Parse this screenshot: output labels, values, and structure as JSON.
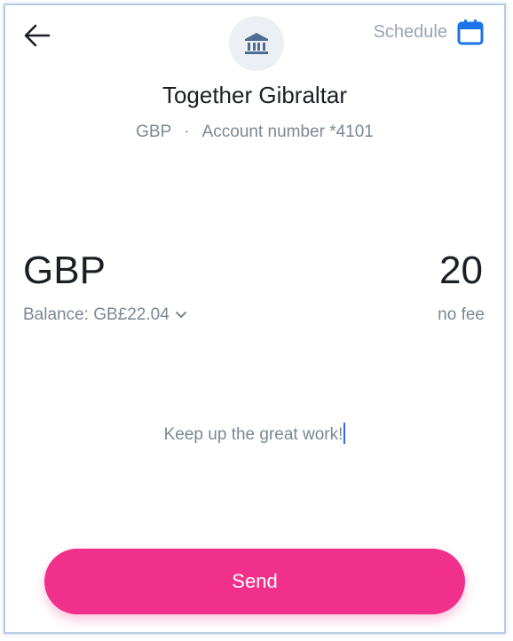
{
  "header": {
    "back_icon": "arrow-left-icon",
    "bank_icon": "bank-icon",
    "schedule_label": "Schedule",
    "schedule_icon": "calendar-icon"
  },
  "recipient": {
    "name": "Together Gibraltar",
    "currency": "GBP",
    "separator": "·",
    "account": "Account number *4101"
  },
  "transfer": {
    "currency": "GBP",
    "amount": "20",
    "balance": "Balance: GB£22.04",
    "balance_icon": "chevron-down-icon",
    "fee": "no fee"
  },
  "note": {
    "text": "Keep up the great work!"
  },
  "send": {
    "label": "Send"
  },
  "colors": {
    "accent": "#f0308a",
    "calendar": "#1a73e8",
    "bank_icon": "#4f6c93",
    "caret": "#3b63ff"
  }
}
